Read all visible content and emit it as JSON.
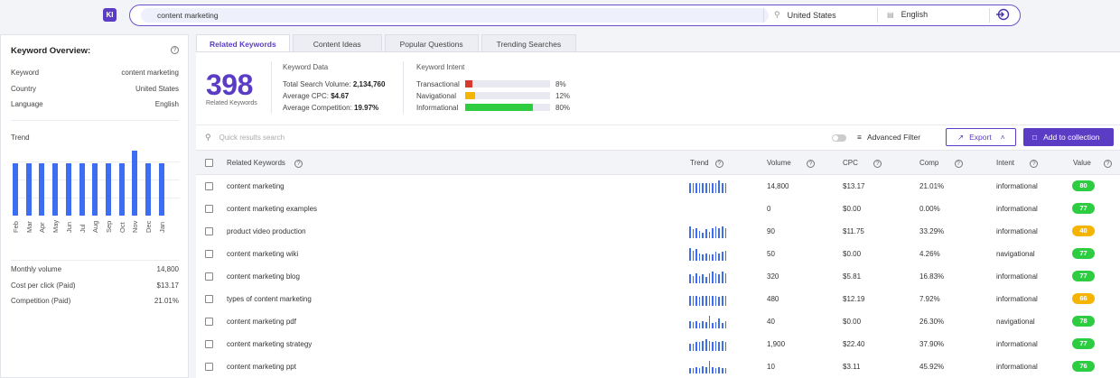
{
  "app": {
    "logo_text": "KI"
  },
  "search": {
    "query": "content marketing",
    "location": "United States",
    "language": "English"
  },
  "overview": {
    "title": "Keyword Overview:",
    "rows": [
      {
        "label": "Keyword",
        "value": "content marketing"
      },
      {
        "label": "Country",
        "value": "United States"
      },
      {
        "label": "Language",
        "value": "English"
      }
    ],
    "trend_label": "Trend",
    "trend_months": [
      "Feb",
      "Mar",
      "Apr",
      "May",
      "Jun",
      "Jul",
      "Aug",
      "Sep",
      "Oct",
      "Nov",
      "Dec",
      "Jan"
    ],
    "trend_values": [
      0.8,
      0.8,
      0.8,
      0.8,
      0.8,
      0.8,
      0.8,
      0.8,
      0.8,
      1.0,
      0.8,
      0.8
    ],
    "stats": [
      {
        "label": "Monthly volume",
        "value": "14,800"
      },
      {
        "label": "Cost per click (Paid)",
        "value": "$13.17"
      },
      {
        "label": "Competition (Paid)",
        "value": "21.01%"
      }
    ]
  },
  "tabs": [
    "Related Keywords",
    "Content Ideas",
    "Popular Questions",
    "Trending Searches"
  ],
  "summary": {
    "count": "398",
    "count_label": "Related Keywords",
    "kd_title": "Keyword Data",
    "kd_rows": [
      {
        "label": "Total Search Volume:",
        "value": "2,134,760"
      },
      {
        "label": "Average CPC:",
        "value": "$4.67"
      },
      {
        "label": "Average Competition:",
        "value": "19.97%"
      }
    ],
    "intent_title": "Keyword Intent",
    "intents": [
      {
        "label": "Transactional",
        "pct": "8%",
        "fraction": 0.08,
        "color": "#d63a2f"
      },
      {
        "label": "Navigational",
        "pct": "12%",
        "fraction": 0.12,
        "color": "#f5b400"
      },
      {
        "label": "Informational",
        "pct": "80%",
        "fraction": 0.8,
        "color": "#2ecc40"
      }
    ]
  },
  "toolbar": {
    "search_placeholder": "Quick results search",
    "advanced_filter": "Advanced Filter",
    "export": "Export",
    "add_collection": "Add to collection"
  },
  "table": {
    "headers": {
      "keyword": "Related Keywords",
      "trend": "Trend",
      "volume": "Volume",
      "cpc": "CPC",
      "comp": "Comp",
      "intent": "Intent",
      "value": "Value"
    },
    "rows": [
      {
        "keyword": "content marketing",
        "volume": "14,800",
        "cpc": "$13.17",
        "comp": "21.01%",
        "intent": "informational",
        "value": "80",
        "value_color": "#2ecc40",
        "trend": [
          0.8,
          0.8,
          0.8,
          0.8,
          0.8,
          0.8,
          0.8,
          0.8,
          0.8,
          1.0,
          0.8,
          0.8
        ]
      },
      {
        "keyword": "content marketing examples",
        "volume": "0",
        "cpc": "$0.00",
        "comp": "0.00%",
        "intent": "informational",
        "value": "77",
        "value_color": "#2ecc40",
        "trend": []
      },
      {
        "keyword": "product video production",
        "volume": "90",
        "cpc": "$11.75",
        "comp": "33.29%",
        "intent": "informational",
        "value": "40",
        "value_color": "#f5b400",
        "trend": [
          0.9,
          0.7,
          0.8,
          0.6,
          0.4,
          0.7,
          0.5,
          0.8,
          0.9,
          0.8,
          0.9,
          0.8
        ]
      },
      {
        "keyword": "content marketing wiki",
        "volume": "50",
        "cpc": "$0.00",
        "comp": "4.26%",
        "intent": "navigational",
        "value": "77",
        "value_color": "#2ecc40",
        "trend": [
          1.0,
          0.8,
          0.9,
          0.6,
          0.5,
          0.6,
          0.5,
          0.5,
          0.7,
          0.6,
          0.7,
          0.8
        ]
      },
      {
        "keyword": "content marketing blog",
        "volume": "320",
        "cpc": "$5.81",
        "comp": "16.83%",
        "intent": "informational",
        "value": "77",
        "value_color": "#2ecc40",
        "trend": [
          0.7,
          0.6,
          0.8,
          0.6,
          0.7,
          0.5,
          0.8,
          0.9,
          0.8,
          0.7,
          0.9,
          0.8
        ]
      },
      {
        "keyword": "types of content marketing",
        "volume": "480",
        "cpc": "$12.19",
        "comp": "7.92%",
        "intent": "informational",
        "value": "66",
        "value_color": "#f5b400",
        "trend": [
          0.8,
          0.8,
          0.8,
          0.7,
          0.8,
          0.8,
          0.8,
          0.8,
          0.8,
          0.7,
          0.8,
          0.8
        ]
      },
      {
        "keyword": "content marketing pdf",
        "volume": "40",
        "cpc": "$0.00",
        "comp": "26.30%",
        "intent": "navigational",
        "value": "78",
        "value_color": "#2ecc40",
        "trend": [
          0.6,
          0.5,
          0.6,
          0.4,
          0.6,
          0.5,
          1.0,
          0.4,
          0.5,
          0.8,
          0.4,
          0.6
        ]
      },
      {
        "keyword": "content marketing strategy",
        "volume": "1,900",
        "cpc": "$22.40",
        "comp": "37.90%",
        "intent": "informational",
        "value": "77",
        "value_color": "#2ecc40",
        "trend": [
          0.6,
          0.6,
          0.7,
          0.7,
          0.8,
          0.9,
          0.8,
          0.7,
          0.8,
          0.7,
          0.8,
          0.7
        ]
      },
      {
        "keyword": "content marketing ppt",
        "volume": "10",
        "cpc": "$3.11",
        "comp": "45.92%",
        "intent": "informational",
        "value": "76",
        "value_color": "#2ecc40",
        "trend": [
          0.4,
          0.4,
          0.5,
          0.4,
          0.6,
          0.5,
          1.0,
          0.5,
          0.4,
          0.5,
          0.4,
          0.4
        ]
      }
    ]
  }
}
